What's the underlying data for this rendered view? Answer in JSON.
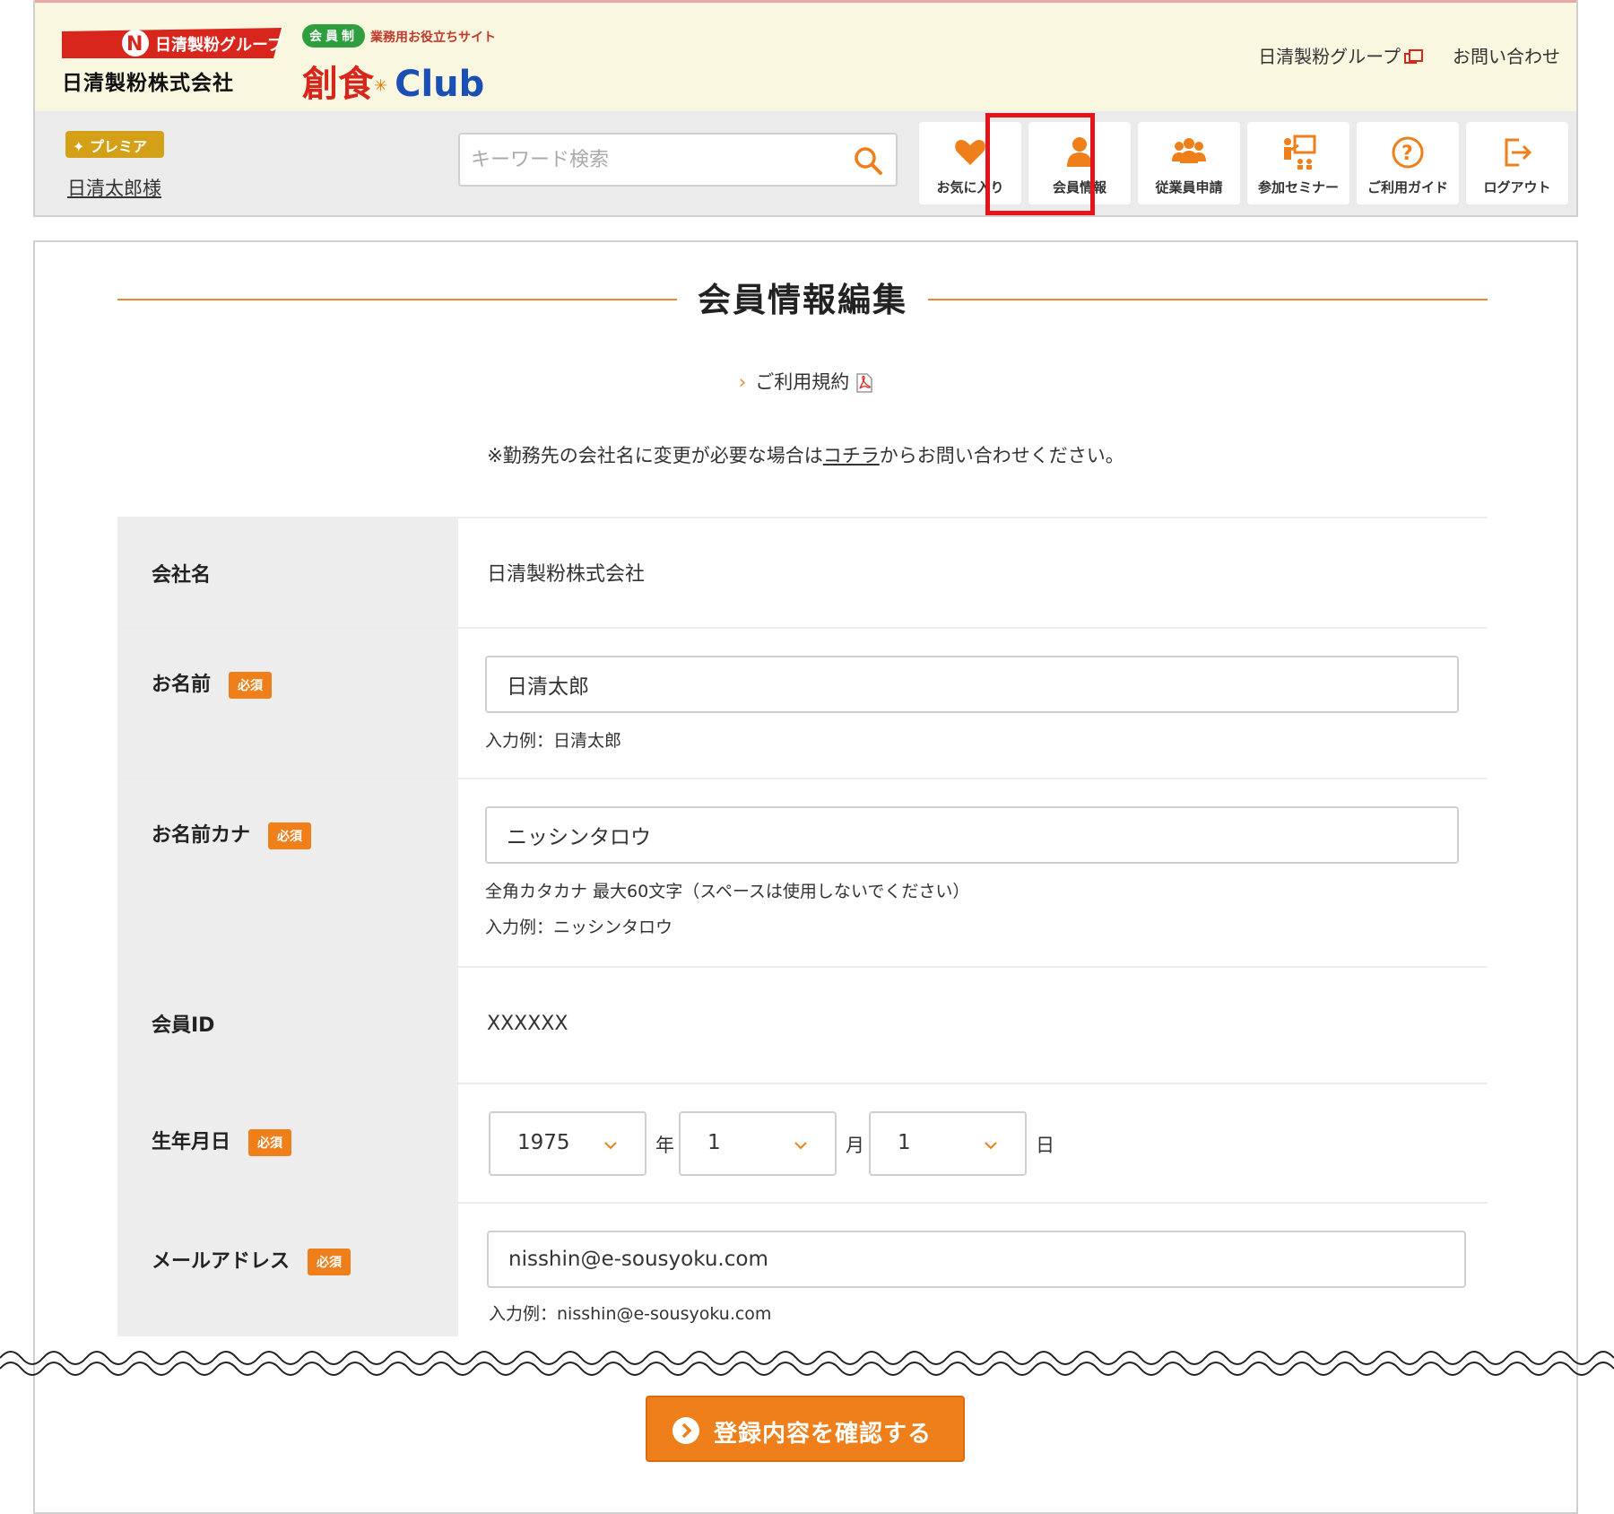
{
  "header": {
    "corp_logo_text": "日清製粉グループ",
    "corp_name": "日清製粉株式会社",
    "sub_pill": "会員制",
    "sub_tag": "業務用お役立ちサイト",
    "sub_brand_jp": "創食",
    "sub_brand_club": "Club",
    "links": [
      "日清製粉グループ",
      "お問い合わせ"
    ],
    "premium_label": "プレミア",
    "username": "日清太郎様",
    "search_placeholder": "キーワード検索",
    "nav": [
      {
        "label": "お気に入り",
        "icon": "heart-icon"
      },
      {
        "label": "会員情報",
        "icon": "person-icon"
      },
      {
        "label": "従業員申請",
        "icon": "group-icon"
      },
      {
        "label": "参加セミナー",
        "icon": "seminar-icon"
      },
      {
        "label": "ご利用ガイド",
        "icon": "question-icon"
      },
      {
        "label": "ログアウト",
        "icon": "logout-icon"
      }
    ]
  },
  "main": {
    "title": "会員情報編集",
    "terms_link": "ご利用規約",
    "notice_before": "※勤務先の会社名に変更が必要な場合は",
    "notice_link": "コチラ",
    "notice_after": "からお問い合わせください。",
    "required_label": "必須",
    "rows": {
      "company": {
        "label": "会社名",
        "value": "日清製粉株式会社"
      },
      "name": {
        "label": "お名前",
        "value": "日清太郎",
        "hint": "入力例：日清太郎"
      },
      "kana": {
        "label": "お名前カナ",
        "value": "ニッシンタロウ",
        "hint1": "全角カタカナ 最大60文字（スペースは使用しないでください）",
        "hint2": "入力例：ニッシンタロウ"
      },
      "member_id": {
        "label": "会員ID",
        "value": "XXXXXX"
      },
      "birthday": {
        "label": "生年月日",
        "year": "1975",
        "month": "1",
        "day": "1",
        "year_unit": "年",
        "month_unit": "月",
        "day_unit": "日"
      },
      "email": {
        "label": "メールアドレス",
        "value": "nisshin@e-sousyoku.com",
        "hint": "入力例：nisshin@e-sousyoku.com"
      }
    },
    "confirm_button": "登録内容を確認する"
  },
  "colors": {
    "accent_orange": "#ee7f1a",
    "highlight_red": "#e4141b",
    "brand_red": "#d9261c",
    "brand_blue": "#1a4fb5",
    "brand_green": "#2f9e3e"
  }
}
